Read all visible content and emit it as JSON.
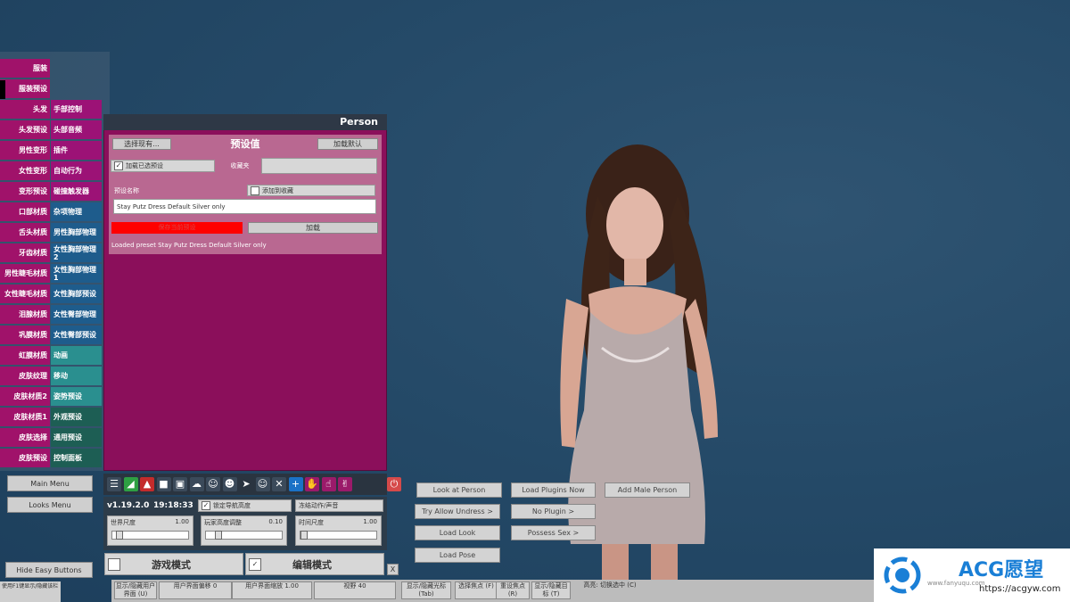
{
  "sidebar_left": [
    {
      "label": "服装",
      "color": "#a0126a"
    },
    {
      "label": "服装预设",
      "color": "#a0126a"
    },
    {
      "label": "头发",
      "color": "#a0126a"
    },
    {
      "label": "头发预设",
      "color": "#a0126a"
    },
    {
      "label": "男性变形",
      "color": "#a0126a"
    },
    {
      "label": "女性变形",
      "color": "#a0126a"
    },
    {
      "label": "变形预设",
      "color": "#a0126a"
    },
    {
      "label": "口部材质",
      "color": "#a0126a"
    },
    {
      "label": "舌头材质",
      "color": "#a0126a"
    },
    {
      "label": "牙齿材质",
      "color": "#a0126a"
    },
    {
      "label": "男性睫毛材质",
      "color": "#a0126a"
    },
    {
      "label": "女性睫毛材质",
      "color": "#a0126a"
    },
    {
      "label": "泪腺材质",
      "color": "#a0126a"
    },
    {
      "label": "巩膜材质",
      "color": "#a0126a"
    },
    {
      "label": "虹膜材质",
      "color": "#a0126a"
    },
    {
      "label": "皮肤纹理",
      "color": "#a0126a"
    },
    {
      "label": "皮肤材质2",
      "color": "#a0126a"
    },
    {
      "label": "皮肤材质1",
      "color": "#a0126a"
    },
    {
      "label": "皮肤选择",
      "color": "#a0126a"
    },
    {
      "label": "皮肤预设",
      "color": "#a0126a"
    }
  ],
  "sidebar_right": [
    {
      "label": "手部控制",
      "color": "#9c1276",
      "row": 2
    },
    {
      "label": "头部音频",
      "color": "#9c1276",
      "row": 3
    },
    {
      "label": "插件",
      "color": "#9c1276",
      "row": 4
    },
    {
      "label": "自动行为",
      "color": "#9c1276",
      "row": 5
    },
    {
      "label": "碰撞触发器",
      "color": "#9c1276",
      "row": 6
    },
    {
      "label": "杂项物理",
      "color": "#1e5c8c",
      "row": 7
    },
    {
      "label": "男性胸部物理",
      "color": "#1e5c8c",
      "row": 8
    },
    {
      "label": "女性胸部物理 2",
      "color": "#1e5c8c",
      "row": 9
    },
    {
      "label": "女性胸部物理 1",
      "color": "#1e5c8c",
      "row": 10
    },
    {
      "label": "女性胸部预设",
      "color": "#1e5c8c",
      "row": 11
    },
    {
      "label": "女性臀部物理",
      "color": "#1e5c8c",
      "row": 12
    },
    {
      "label": "女性臀部预设",
      "color": "#1e5c8c",
      "row": 13
    },
    {
      "label": "动画",
      "color": "#2a8f8f",
      "row": 14
    },
    {
      "label": "移动",
      "color": "#2a8f8f",
      "row": 15
    },
    {
      "label": "姿势预设",
      "color": "#2a8f8f",
      "row": 16
    },
    {
      "label": "外观预设",
      "color": "#1d5e54",
      "row": 17
    },
    {
      "label": "通用预设",
      "color": "#1d5e54",
      "row": 18
    },
    {
      "label": "控制面板",
      "color": "#1d5e54",
      "row": 19
    }
  ],
  "left_buttons": {
    "main_menu": "Main Menu",
    "looks_menu": "Looks Menu",
    "hide_easy": "Hide Easy Buttons"
  },
  "footer_left_text": "使用F1键显示/隐藏该栏",
  "person_panel": {
    "title": "Person",
    "select_existing": "选择现有...",
    "preset_value": "预设值",
    "load_default": "加载默认",
    "load_checked": "加载已选预设",
    "favorites": "收藏夹",
    "preset_name_label": "预设名称",
    "add_to_favorites": "添加到收藏",
    "preset_name_value": "Stay Putz Dress Default Silver only",
    "save_label": "保存当前预设",
    "load_label": "加载",
    "status": "Loaded preset Stay Putz Dress Default Silver only"
  },
  "toolbar_icons": [
    "menu-icon",
    "mode-icon",
    "clothing-icon",
    "box-icon",
    "package-icon",
    "cloud-icon",
    "person-add-icon",
    "person-edit-icon",
    "cursor-icon",
    "people-icon",
    "tools-icon",
    "plus-icon",
    "hand-icon",
    "hand2-icon",
    "hand3-icon",
    "power-icon"
  ],
  "status": {
    "version": "v1.19.2.0",
    "time": "19:18:33",
    "lock_nav": "锁定导航高度",
    "freeze_motion": "冻结动作/声音"
  },
  "sliders": [
    {
      "label": "世界尺度",
      "value": "1.00",
      "level": 0.05
    },
    {
      "label": "玩家高度调整",
      "value": "0.10",
      "level": 0.12
    },
    {
      "label": "时间尺度",
      "value": "1.00",
      "level": 0.0
    }
  ],
  "modes": {
    "play": "游戏模式",
    "edit": "编辑模式",
    "close": "X"
  },
  "world_buttons": [
    {
      "label": "Look at Person",
      "name": "look-at-person-button"
    },
    {
      "label": "Load Plugins Now",
      "name": "load-plugins-button"
    },
    {
      "label": "Add Male Person",
      "name": "add-male-person-button"
    },
    {
      "label": "Try Allow Undress >",
      "name": "try-allow-undress-button"
    },
    {
      "label": "No Plugin >",
      "name": "no-plugin-button"
    },
    {
      "label": "Load Look",
      "name": "load-look-button"
    },
    {
      "label": "Possess Sex >",
      "name": "possess-sex-button"
    },
    {
      "label": "Load Pose",
      "name": "load-pose-button"
    }
  ],
  "bottom_bar": [
    {
      "label": "显示/隐藏用户界面 (U)"
    },
    {
      "label": "用户界面偏移 0"
    },
    {
      "label": "用户界面缩放 1.00"
    },
    {
      "label": "视野 40"
    },
    {
      "label": "显示/隐藏光标 (Tab)"
    },
    {
      "label": "选择焦点 (F)"
    },
    {
      "label": "重设焦点 (R)"
    },
    {
      "label": "显示/隐藏目标 (T)"
    },
    {
      "label": "高亮: 切换选中 (C)"
    }
  ],
  "watermark": {
    "brand": "ACG愿望",
    "url": "https://acgyw.com",
    "small": "www.fanyuqu.com"
  }
}
